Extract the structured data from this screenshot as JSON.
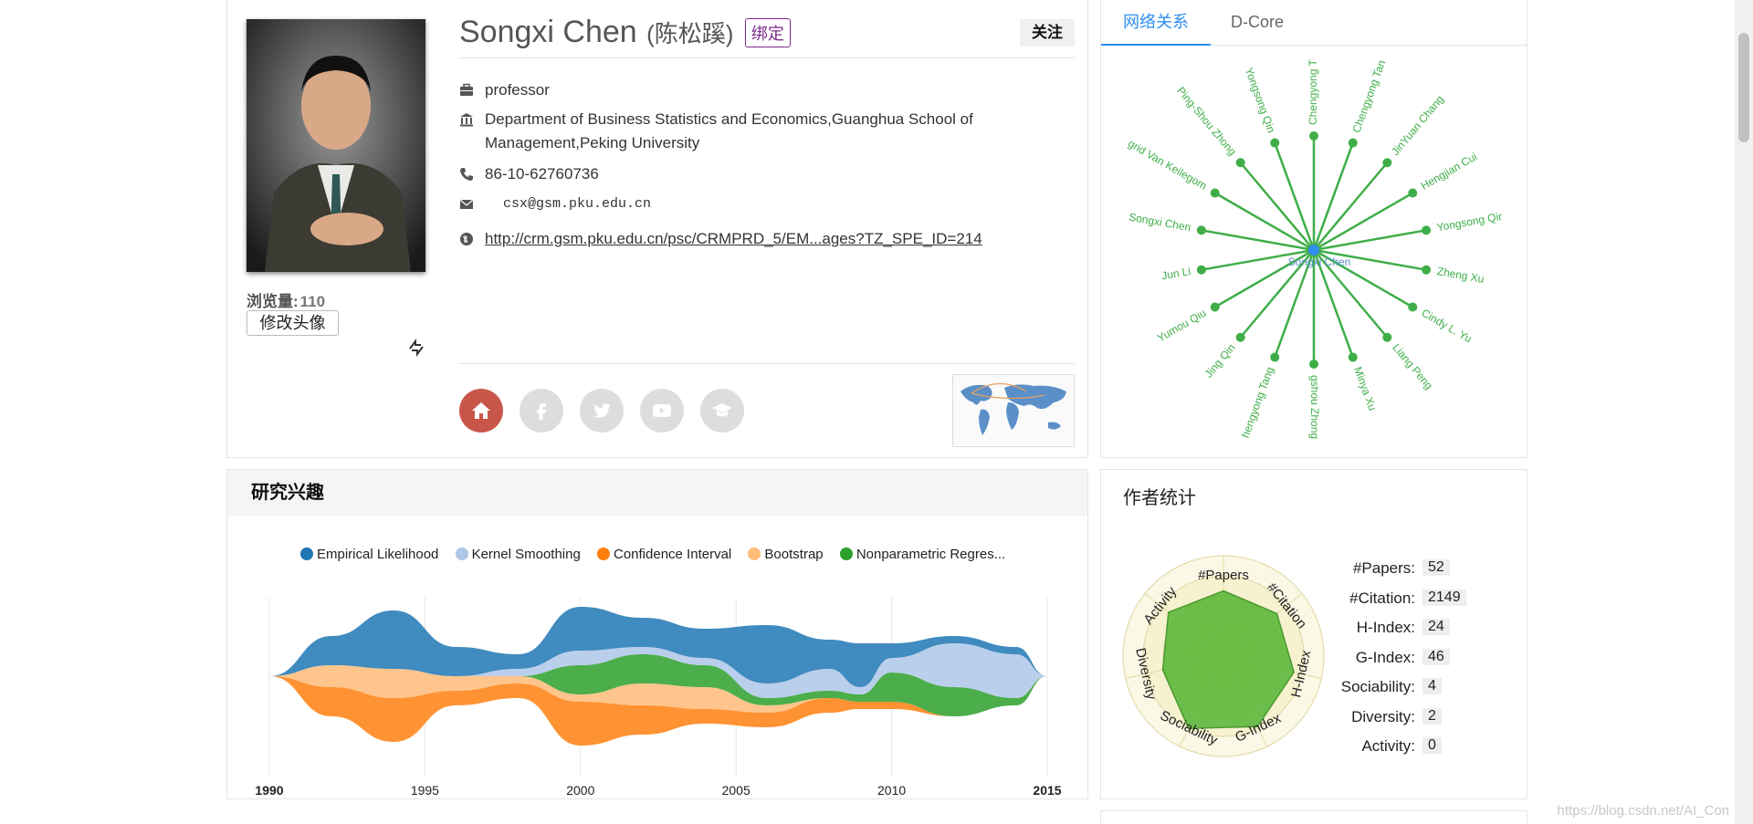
{
  "profile": {
    "name": "Songxi Chen",
    "name_cn": "(陈松蹊)",
    "bind_label": "绑定",
    "follow_label": "关注",
    "views_label": "浏览量:",
    "views_count": "110",
    "change_avatar_label": "修改头像",
    "title": "professor",
    "department": "Department of Business Statistics and Economics,Guanghua School of Management,Peking University",
    "phone": "86-10-62760736",
    "email": "csx@gsm.pku.edu.cn",
    "homepage": "http://crm.gsm.pku.edu.cn/psc/CRMPRD_5/EM...ages?TZ_SPE_ID=214",
    "social_icons": [
      "home-icon",
      "facebook-icon",
      "twitter-icon",
      "youtube-icon",
      "scholar-icon"
    ],
    "accent_home": "#c9564b"
  },
  "network": {
    "tabs": [
      {
        "label": "网络关系"
      },
      {
        "label": "D-Core"
      }
    ],
    "center": "Songxi Chen",
    "color": "#3fae49",
    "nodes": [
      "Chengyong T",
      "Chengyong Tan",
      "JinYuan Chang",
      "Hengjian Cui",
      "Yongsong Qir",
      "Zheng Xu",
      "Cindy L. Yu",
      "Liang Peng",
      "Minya Xu",
      "gshou Zhong",
      "hengyong Tang",
      "Jing Qin",
      "Yumou Qiu",
      "Jun Li",
      "Songxi Chen",
      "grid Van Keilegom",
      "Ping-Shou Zhong",
      "Yongsong Qin"
    ]
  },
  "research": {
    "title": "研究兴趣",
    "legend_overflow": "..."
  },
  "stats": {
    "title": "作者统计",
    "rows": [
      {
        "label": "#Papers:",
        "value": "52"
      },
      {
        "label": "#Citation:",
        "value": "2149"
      },
      {
        "label": "H-Index:",
        "value": "24"
      },
      {
        "label": "G-Index:",
        "value": "46"
      },
      {
        "label": "Sociability:",
        "value": "4"
      },
      {
        "label": "Diversity:",
        "value": "2"
      },
      {
        "label": "Activity:",
        "value": "0"
      }
    ],
    "radar_axes": [
      "#Papers",
      "#Citation",
      "H-Index",
      "G-Index",
      "Sociability",
      "Diversity",
      "Activity"
    ],
    "radar_levels": [
      0.65,
      0.68,
      0.72,
      0.78,
      0.8,
      0.62,
      0.7
    ]
  },
  "watermark": "https://blog.csdn.net/AI_Con",
  "chart_data": {
    "type": "area",
    "x": [
      1990,
      1992,
      1994,
      1996,
      1998,
      2000,
      2002,
      2004,
      2006,
      2008,
      2009,
      2010,
      2012,
      2014,
      2015
    ],
    "xticks": [
      "1990",
      "1995",
      "2000",
      "2005",
      "2010",
      "2015"
    ],
    "series": [
      {
        "name": "Empirical Likelihood",
        "color": "#1f77b4",
        "values": [
          0,
          2,
          4,
          2,
          1,
          3,
          2,
          2,
          4,
          2,
          3,
          1,
          0.5,
          0.5,
          0
        ]
      },
      {
        "name": "Kernel Smoothing",
        "color": "#aec7e8",
        "values": [
          0,
          0,
          0,
          0,
          0.5,
          1,
          0.5,
          0.5,
          1,
          1.5,
          0.5,
          1,
          3,
          3,
          0
        ]
      },
      {
        "name": "Confidence Interval",
        "color": "#ff7f0e",
        "values": [
          0,
          2,
          3,
          1,
          1,
          3,
          2,
          1,
          1,
          1,
          0.5,
          0.5,
          0,
          0,
          0
        ]
      },
      {
        "name": "Bootstrap",
        "color": "#ffbb78",
        "values": [
          0,
          1.5,
          2,
          1,
          0.5,
          0.5,
          1.5,
          1.5,
          0.5,
          0,
          0,
          0,
          0,
          0,
          0
        ]
      },
      {
        "name": "Nonparametric Regres",
        "color": "#2ca02c",
        "values": [
          0,
          0,
          0,
          0,
          0,
          2,
          2,
          1.5,
          0.5,
          0.5,
          0.5,
          2,
          2,
          0.5,
          0
        ]
      }
    ]
  }
}
